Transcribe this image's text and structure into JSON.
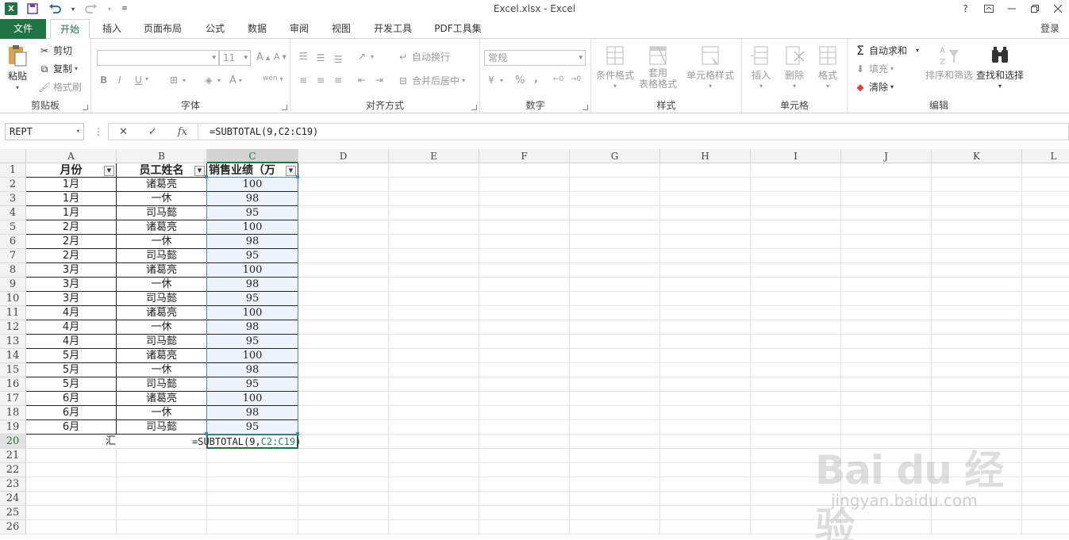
{
  "window": {
    "title": "Excel.xlsx - Excel",
    "help": "?",
    "login": "登录"
  },
  "quick_access": {
    "app_icon": "X"
  },
  "tabs": [
    "文件",
    "开始",
    "插入",
    "页面布局",
    "公式",
    "数据",
    "审阅",
    "视图",
    "开发工具",
    "PDF工具集"
  ],
  "ribbon": {
    "clipboard": {
      "name": "剪贴板",
      "paste": "粘贴",
      "cut": "剪切",
      "copy": "复制",
      "format_painter": "格式刷"
    },
    "font": {
      "name": "字体",
      "size": "11",
      "bold": "B",
      "italic": "I",
      "underline": "U",
      "grow": "A",
      "shrink": "A",
      "color": "A",
      "wen": "wén"
    },
    "alignment": {
      "name": "对齐方式",
      "wrap": "自动换行",
      "merge": "合并后居中"
    },
    "number": {
      "name": "数字",
      "format": "常规",
      "percent": "%",
      "comma": ",",
      "inc": "←0",
      "dec": "→0"
    },
    "styles": {
      "name": "样式",
      "conditional": "条件格式",
      "table_1": "套用",
      "table_2": "表格格式",
      "cell_styles": "单元格样式"
    },
    "cells": {
      "name": "单元格",
      "insert": "插入",
      "delete": "删除",
      "format": "格式"
    },
    "editing": {
      "name": "编辑",
      "autosum": "自动求和",
      "fill": "填充",
      "clear": "清除",
      "sort": "排序和筛选",
      "find": "查找和选择"
    }
  },
  "formula_bar": {
    "name_box": "REPT",
    "cancel": "✕",
    "enter": "✓",
    "fx": "fx",
    "formula": "=SUBTOTAL(9,C2:C19)"
  },
  "sheet": {
    "columns": [
      "A",
      "B",
      "C",
      "D",
      "E",
      "F",
      "G",
      "H",
      "I",
      "J",
      "K",
      "L"
    ],
    "row_numbers": [
      "1",
      "2",
      "3",
      "4",
      "5",
      "6",
      "7",
      "8",
      "9",
      "10",
      "11",
      "12",
      "13",
      "14",
      "15",
      "16",
      "17",
      "18",
      "19",
      "20",
      "21",
      "22",
      "23",
      "24",
      "25",
      "26"
    ],
    "headers": [
      "月份",
      "员工姓名",
      "销售业绩（万"
    ],
    "rows": [
      [
        "1月",
        "诸葛亮",
        "100"
      ],
      [
        "1月",
        "一休",
        "98"
      ],
      [
        "1月",
        "司马懿",
        "95"
      ],
      [
        "2月",
        "诸葛亮",
        "100"
      ],
      [
        "2月",
        "一休",
        "98"
      ],
      [
        "2月",
        "司马懿",
        "95"
      ],
      [
        "3月",
        "诸葛亮",
        "100"
      ],
      [
        "3月",
        "一休",
        "98"
      ],
      [
        "3月",
        "司马懿",
        "95"
      ],
      [
        "4月",
        "诸葛亮",
        "100"
      ],
      [
        "4月",
        "一休",
        "98"
      ],
      [
        "4月",
        "司马懿",
        "95"
      ],
      [
        "5月",
        "诸葛亮",
        "100"
      ],
      [
        "5月",
        "一休",
        "98"
      ],
      [
        "5月",
        "司马懿",
        "95"
      ],
      [
        "6月",
        "诸葛亮",
        "100"
      ],
      [
        "6月",
        "一休",
        "98"
      ],
      [
        "6月",
        "司马懿",
        "95"
      ]
    ],
    "row20_label": "汇",
    "editing_formula_prefix": "=SUBTOTAL(9,",
    "editing_formula_ref": "C2:C19",
    "editing_formula_suffix": ")"
  },
  "watermark": {
    "logo": "Bai du 经验",
    "url": "jingyan.baidu.com"
  }
}
